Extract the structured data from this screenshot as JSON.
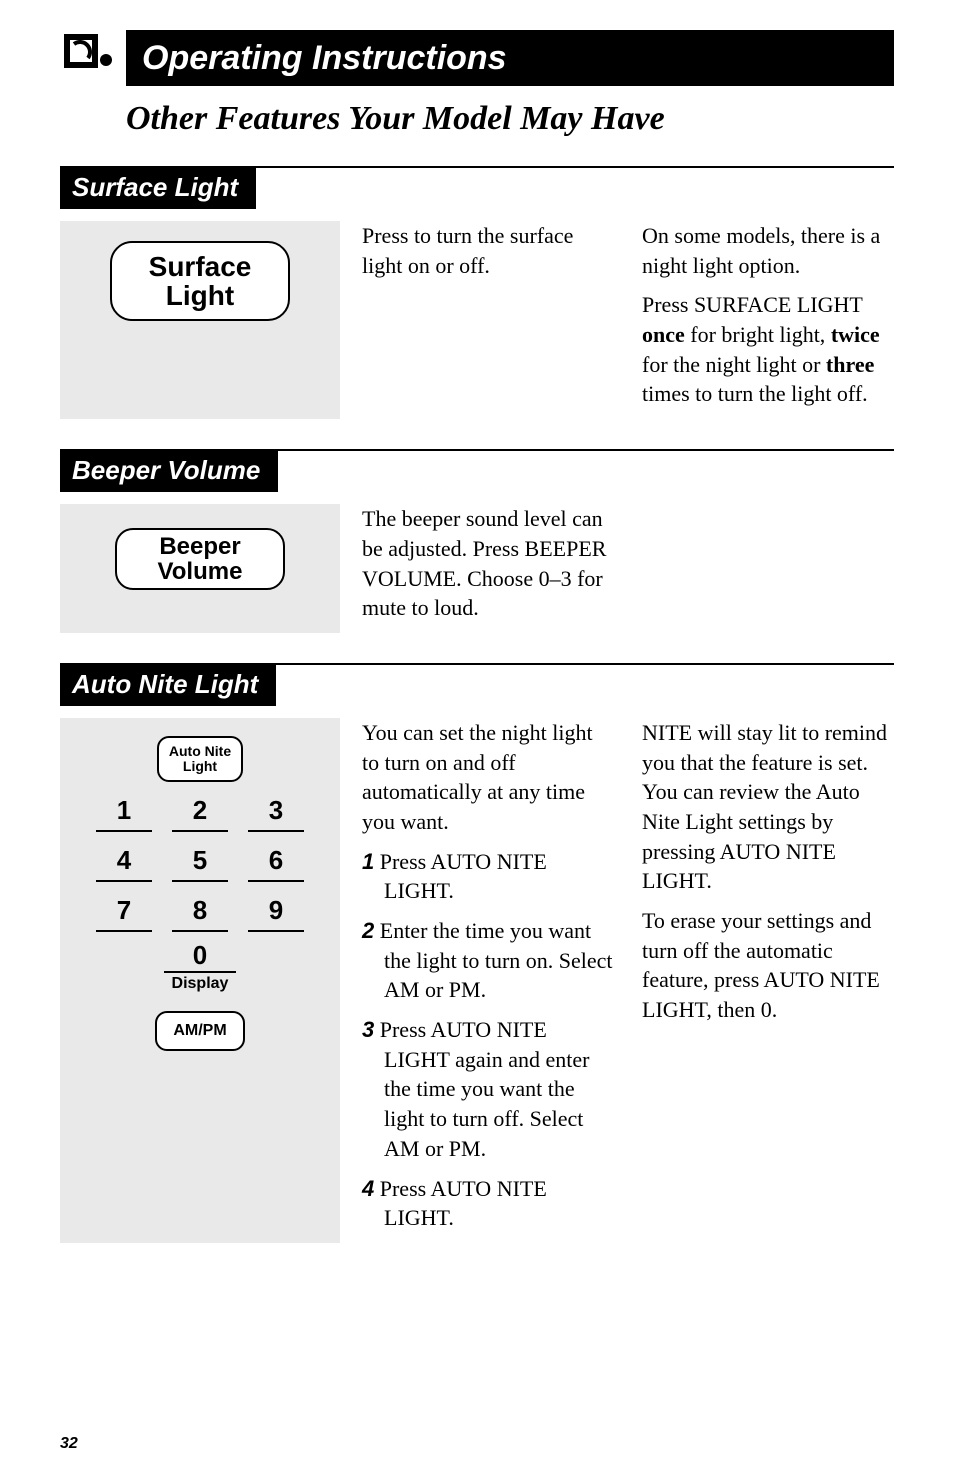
{
  "page_number": "32",
  "title": "Operating Instructions",
  "subtitle": "Other Features Your Model May Have",
  "sections": {
    "surface_light": {
      "heading": "Surface Light",
      "button_line1": "Surface",
      "button_line2": "Light",
      "col1": "Press to turn the surface light on or off.",
      "col2a": "On some models, there is a night light option.",
      "col2b_pre": "Press SURFACE LIGHT ",
      "col2b_once": "once",
      "col2b_mid1": " for bright light, ",
      "col2b_twice": "twice",
      "col2b_mid2": " for the night light or ",
      "col2b_three": "three",
      "col2b_end": " times to turn the light off."
    },
    "beeper": {
      "heading": "Beeper Volume",
      "button_line1": "Beeper",
      "button_line2": "Volume",
      "col1": "The beeper sound level can be adjusted. Press BEEPER VOLUME. Choose 0–3 for mute to loud."
    },
    "autonite": {
      "heading": "Auto Nite Light",
      "btn_line1": "Auto Nite",
      "btn_line2": "Light",
      "keys": [
        "1",
        "2",
        "3",
        "4",
        "5",
        "6",
        "7",
        "8",
        "9"
      ],
      "zero": "0",
      "display_label": "Display",
      "ampm_label": "AM/PM",
      "intro": "You can set the night light to turn on and off automatically at any time you want.",
      "steps": [
        {
          "n": "1",
          "t": "Press AUTO NITE LIGHT."
        },
        {
          "n": "2",
          "t": "Enter the time you want the light to turn on. Select AM or PM."
        },
        {
          "n": "3",
          "t": "Press AUTO NITE LIGHT again and enter the time you want the light to turn off. Select AM or PM."
        },
        {
          "n": "4",
          "t": "Press AUTO NITE LIGHT."
        }
      ],
      "col2a": "NITE will stay lit to remind you that the feature is set. You can review the Auto Nite Light settings by pressing AUTO NITE LIGHT.",
      "col2b": "To erase your settings and turn off the automatic feature, press AUTO NITE LIGHT, then 0."
    }
  }
}
